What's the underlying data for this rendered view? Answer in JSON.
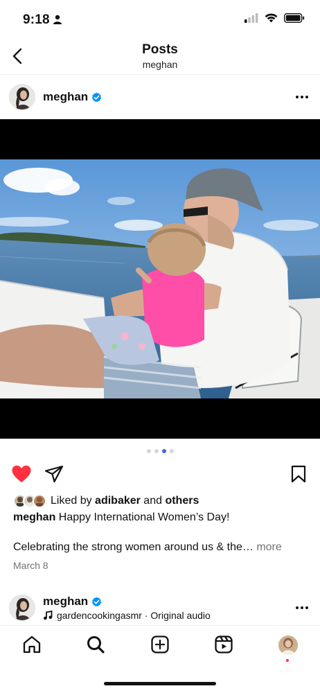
{
  "status_bar": {
    "time": "9:18",
    "icons": [
      "person-icon",
      "cellular-signal-icon",
      "wifi-icon",
      "battery-icon"
    ]
  },
  "header": {
    "title": "Posts",
    "subtitle": "meghan",
    "back_icon": "chevron-left-icon"
  },
  "post": {
    "username": "meghan",
    "verified": true,
    "more_icon": "more-horizontal-icon",
    "carousel": {
      "count": 4,
      "active_index": 2
    },
    "liked": true,
    "liked_by_prefix": "Liked by ",
    "liked_by_user": "adibaker",
    "liked_by_and": " and ",
    "liked_by_others": "others",
    "caption_user": "meghan",
    "caption_text": " Happy International Women’s Day!",
    "caption_body": "Celebrating the strong women around us & the… ",
    "more_label": "more",
    "date": "March 8"
  },
  "next_post": {
    "username": "meghan",
    "verified": true,
    "audio_track": "gardencookingasmr",
    "audio_separator": " · ",
    "audio_label": "Original audio"
  },
  "bottom_nav": {
    "items": [
      "home-icon",
      "search-icon",
      "create-post-icon",
      "reels-icon",
      "profile-avatar"
    ]
  },
  "colors": {
    "like_red": "#ff3040",
    "verified_blue": "#0095f6",
    "carousel_active": "#3f6ad8",
    "muted_text": "#737373"
  }
}
